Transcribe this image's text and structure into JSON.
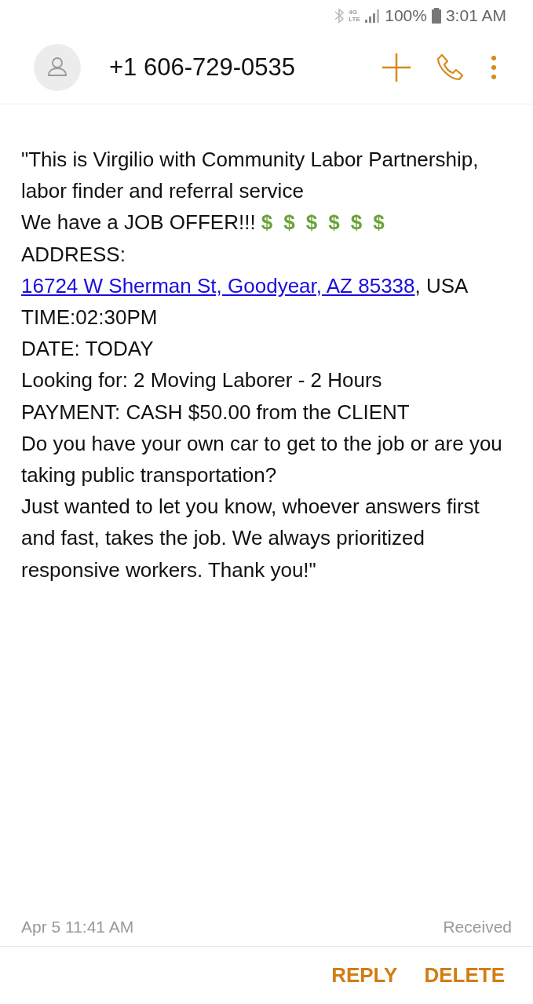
{
  "status_bar": {
    "network": "4G LTE",
    "battery": "100%",
    "time": "3:01 AM"
  },
  "header": {
    "title": "+1 606-729-0535"
  },
  "message": {
    "intro": "\"This is Virgilio with Community Labor Partnership, labor finder and referral service\nWe have a JOB OFFER!!!",
    "emojis": [
      "$",
      "$",
      "$",
      "$",
      "$",
      "$"
    ],
    "address_label": "ADDRESS: ",
    "link": "16724 W Sherman St, Goodyear, AZ 85338",
    "after_link": ", USA\nTIME:02:30PM\nDATE: TODAY\nLooking for: 2 Moving Laborer - 2 Hours\nPAYMENT: CASH $50.00 from the CLIENT\nDo you have your own car to get to the job or are you taking public transportation?\nJust wanted to let you know, whoever answers first and fast, takes the job. We always prioritized responsive workers. Thank you!\""
  },
  "footer": {
    "date": "Apr 5 11:41 AM",
    "status": "Received"
  },
  "buttons": [
    "REPLY",
    "DELETE"
  ]
}
